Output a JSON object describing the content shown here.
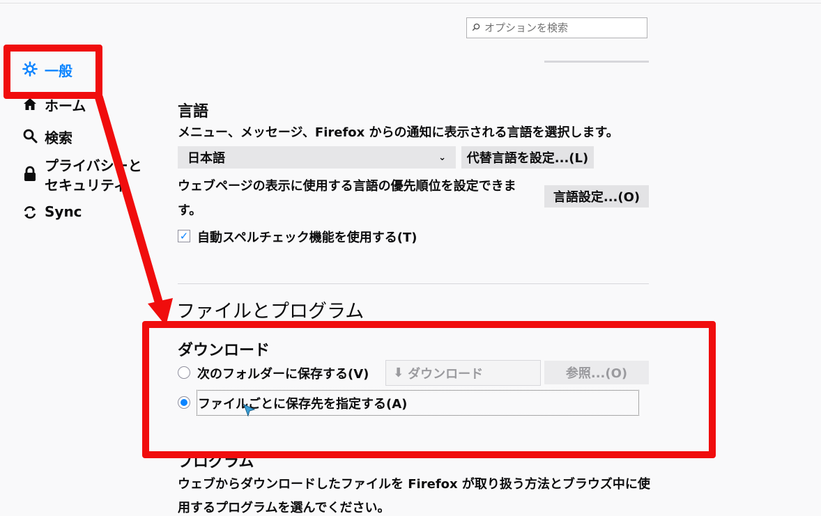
{
  "search": {
    "placeholder": "オプションを検索"
  },
  "sidebar": {
    "items": [
      {
        "label": "一般",
        "icon": "gear-icon"
      },
      {
        "label": "ホーム",
        "icon": "home-icon"
      },
      {
        "label": "検索",
        "icon": "search-icon"
      },
      {
        "label": "プライバシーと",
        "label2": "セキュリティ",
        "icon": "lock-icon"
      },
      {
        "label": "Sync",
        "icon": "sync-icon"
      }
    ]
  },
  "language": {
    "heading": "言語",
    "desc": "メニュー、メッセージ、Firefox からの通知に表示される言語を選択します。",
    "selected": "日本語",
    "alt_button": "代替言語を設定...(L)",
    "web_desc_line1": "ウェブページの表示に使用する言語の優先順位を設定できま",
    "web_desc_line2": "す。",
    "lang_settings_button": "言語設定...(O)",
    "spellcheck_label": "自動スペルチェック機能を使用する(T)",
    "spellcheck_checked": true
  },
  "files": {
    "heading": "ファイルとプログラム",
    "download_heading": "ダウンロード",
    "save_to_label": "次のフォルダーに保存する(V)",
    "folder_value": "ダウンロード",
    "browse_button": "参照...(O)",
    "ask_label": "ファイルごとに保存先を指定する(A)",
    "selected_option": "ask",
    "programs_heading": "プログラム",
    "programs_desc_line1": "ウェブからダウンロードしたファイルを Firefox が取り扱う方法とブラウズ中に使",
    "programs_desc_line2": "用するプログラムを選んでください。"
  },
  "colors": {
    "accent": "#0a84ff",
    "annotation": "#f00d0d"
  }
}
